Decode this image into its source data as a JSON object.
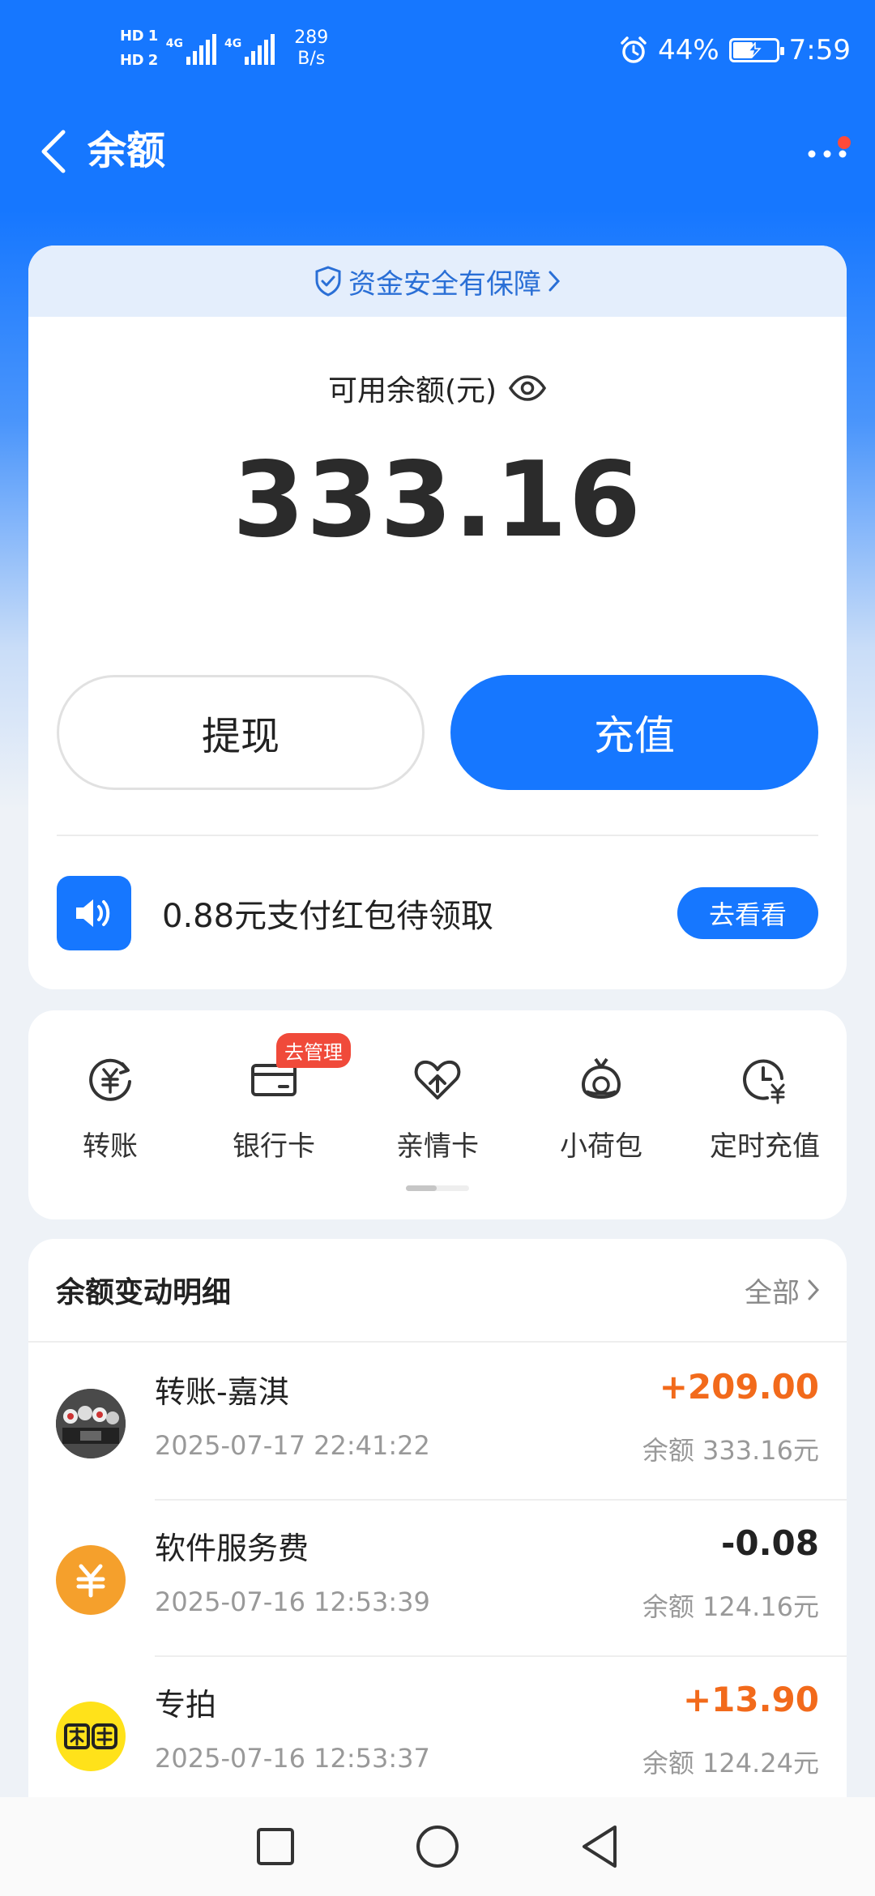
{
  "status_bar": {
    "hd1": "HD 1",
    "hd2": "HD 2",
    "sim1_network": "4G",
    "sim2_network": "4G",
    "speed_value": "289",
    "speed_unit": "B/s",
    "battery_percent": "44%",
    "time": "7:59"
  },
  "header": {
    "title": "余额"
  },
  "balance": {
    "security_text": "资金安全有保障",
    "label": "可用余额(元)",
    "amount": "333.16",
    "withdraw_label": "提现",
    "recharge_label": "充值",
    "promo_text": "0.88元支付红包待领取",
    "promo_button": "去看看"
  },
  "actions": [
    {
      "label": "转账",
      "icon": "transfer-yuan-icon"
    },
    {
      "label": "银行卡",
      "icon": "bank-card-icon",
      "tag": "去管理"
    },
    {
      "label": "亲情卡",
      "icon": "family-card-icon"
    },
    {
      "label": "小荷包",
      "icon": "small-pouch-icon"
    },
    {
      "label": "定时充值",
      "icon": "scheduled-recharge-icon"
    }
  ],
  "transactions": {
    "title": "余额变动明细",
    "all_label": "全部",
    "items": [
      {
        "name": "转账-嘉淇",
        "time": "2025-07-17 22:41:22",
        "amount": "+209.00",
        "balance": "余额 333.16元"
      },
      {
        "name": "软件服务费",
        "time": "2025-07-16 12:53:39",
        "amount": "-0.08",
        "balance": "余额 124.16元"
      },
      {
        "name": "专拍",
        "time": "2025-07-16 12:53:37",
        "amount": "+13.90",
        "balance": "余额 124.24元"
      }
    ]
  },
  "colors": {
    "primary_blue": "#1677ff",
    "income_orange": "#f26a1b",
    "tag_red": "#f04a3a"
  }
}
